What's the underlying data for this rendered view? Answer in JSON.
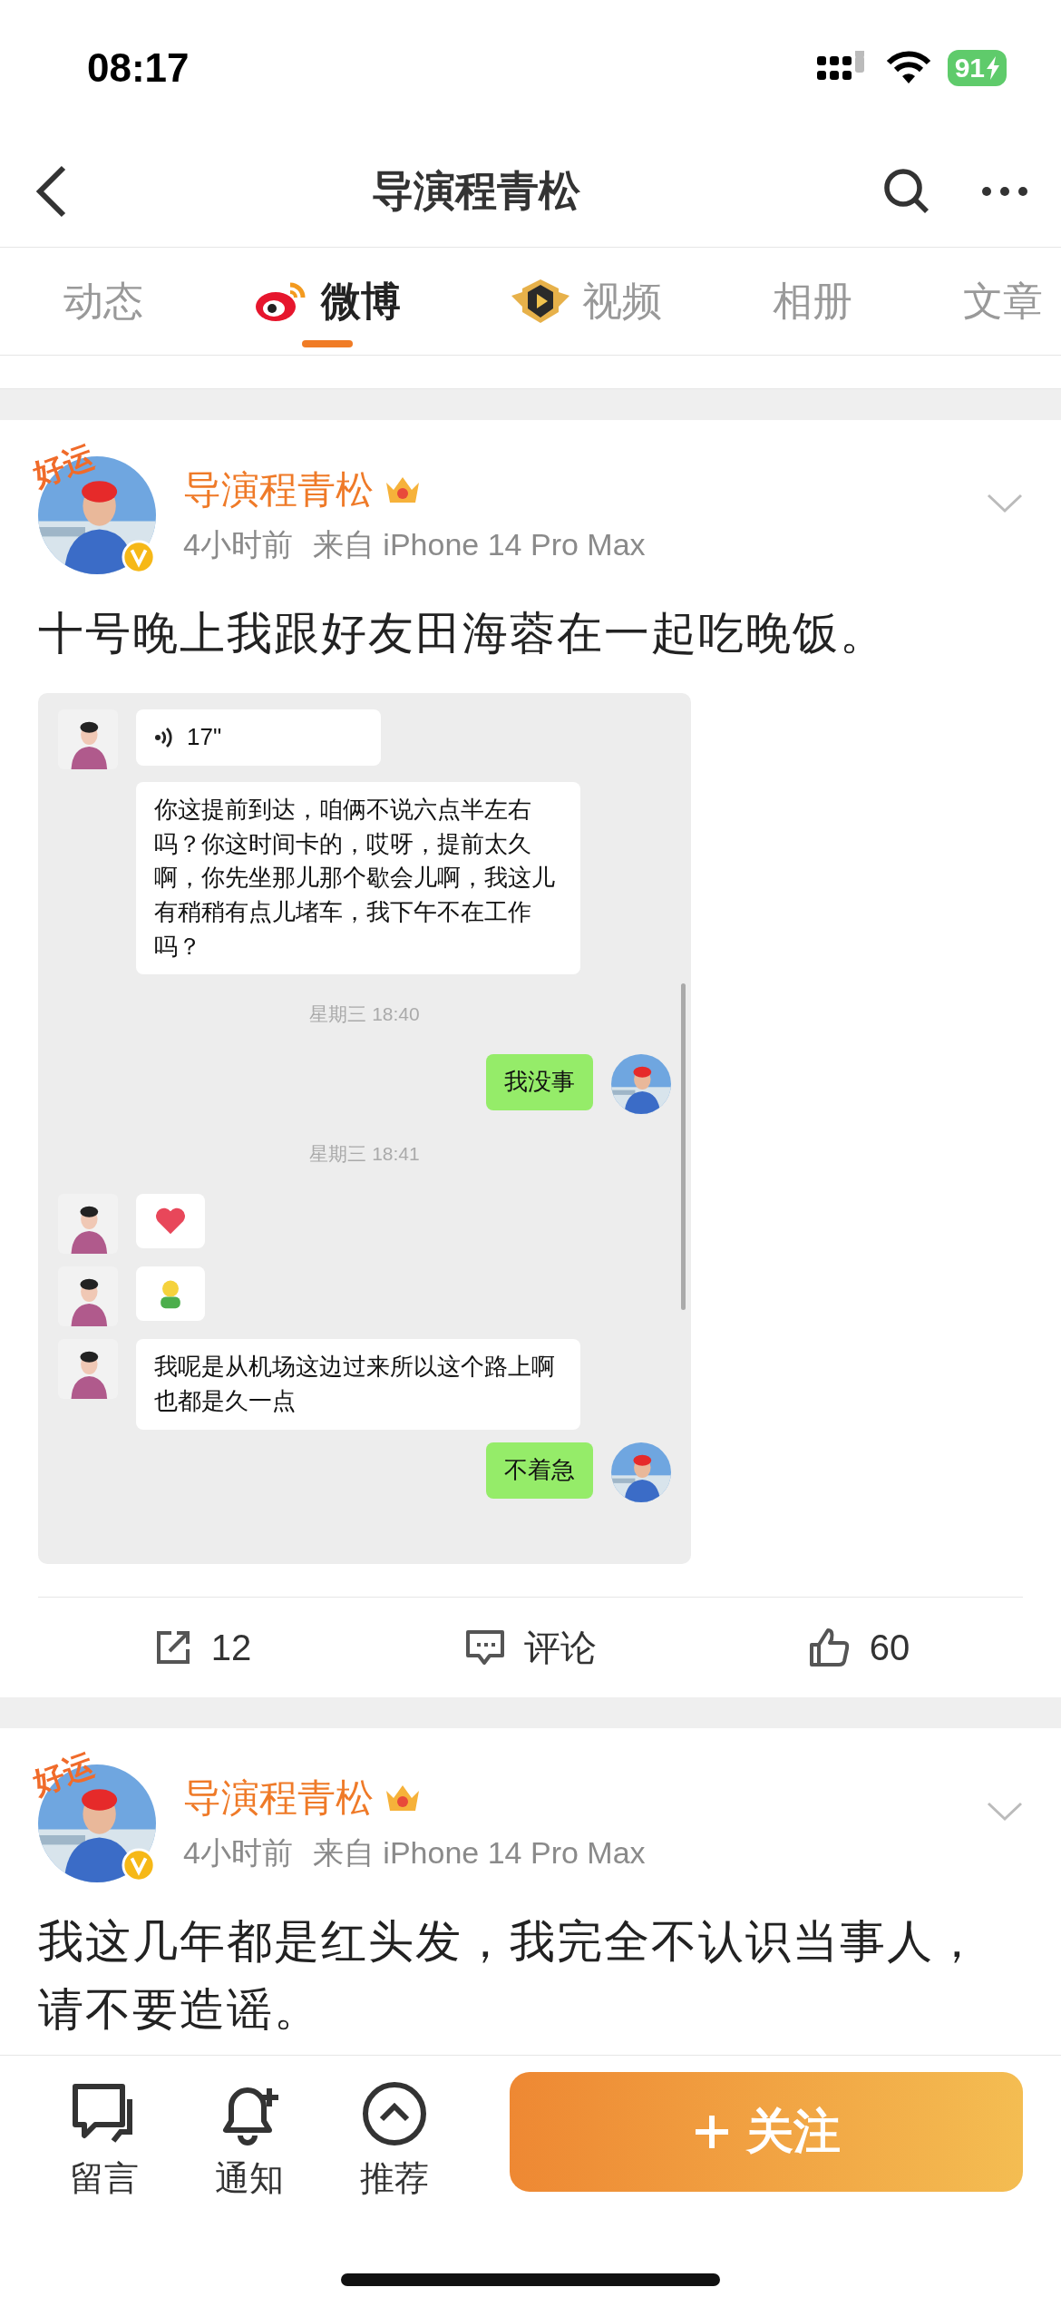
{
  "status_bar": {
    "time": "08:17",
    "battery": "91"
  },
  "nav": {
    "title": "导演程青松"
  },
  "tabs": [
    {
      "label": "动态",
      "selected": false,
      "kind": "plain"
    },
    {
      "label": "微博",
      "selected": true,
      "kind": "weibo"
    },
    {
      "label": "视频",
      "selected": false,
      "kind": "video"
    },
    {
      "label": "相册",
      "selected": false,
      "kind": "plain"
    },
    {
      "label": "文章",
      "selected": false,
      "kind": "plain"
    }
  ],
  "posts": [
    {
      "author": "导演程青松",
      "badge": "好运",
      "verified": true,
      "time": "4小时前",
      "source": "来自 iPhone 14 Pro Max",
      "text": "十号晚上我跟好友田海蓉在一起吃晚饭。",
      "chat": [
        {
          "kind": "voice",
          "outgoing": false,
          "avatar": true,
          "text": "17\""
        },
        {
          "kind": "text",
          "outgoing": false,
          "avatar": false,
          "text": "你这提前到达，咱俩不说六点半左右吗？你这时间卡的，哎呀，提前太久啊，你先坐那儿那个歇会儿啊，我这儿有稍稍有点儿堵车，我下午不在工作吗？"
        },
        {
          "kind": "time",
          "text": "星期三 18:40"
        },
        {
          "kind": "text",
          "outgoing": true,
          "avatar": true,
          "text": "我没事"
        },
        {
          "kind": "time",
          "text": "星期三 18:41"
        },
        {
          "kind": "heart",
          "outgoing": false,
          "avatar": true
        },
        {
          "kind": "sticker",
          "outgoing": false,
          "avatar": true
        },
        {
          "kind": "text",
          "outgoing": false,
          "avatar": true,
          "text": "我呢是从机场这边过来所以这个路上啊也都是久一点"
        },
        {
          "kind": "text",
          "outgoing": true,
          "avatar": true,
          "text": "不着急"
        }
      ],
      "actions": {
        "reposts": "12",
        "comments": "评论",
        "likes": "60"
      }
    },
    {
      "author": "导演程青松",
      "badge": "好运",
      "verified": true,
      "time": "4小时前",
      "source": "来自 iPhone 14 Pro Max",
      "text": "我这几年都是红头发，我完全不认识当事人，请不要造谣。"
    }
  ],
  "bottom_bar": {
    "items": [
      {
        "kind": "message",
        "label": "留言"
      },
      {
        "kind": "bell",
        "label": "通知"
      },
      {
        "kind": "up",
        "label": "推荐"
      }
    ],
    "follow": "关注"
  }
}
